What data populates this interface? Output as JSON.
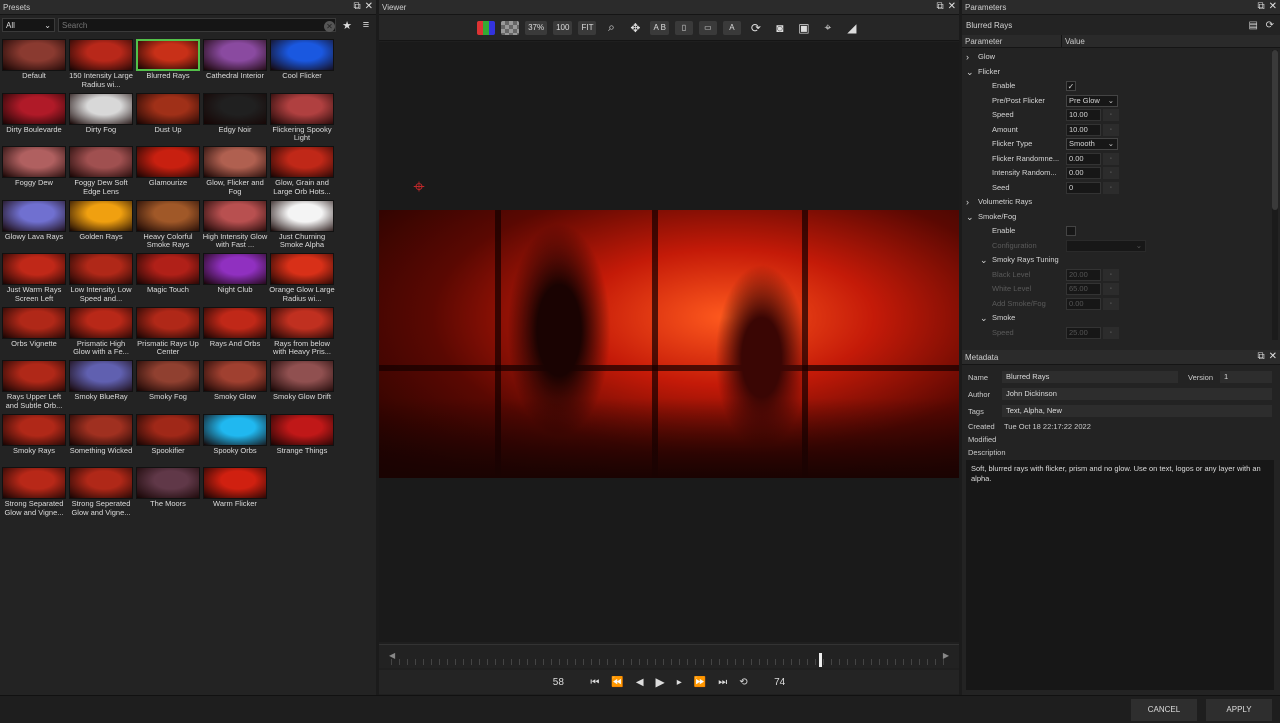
{
  "presets": {
    "title": "Presets",
    "filter": "All",
    "search_placeholder": "Search",
    "items": [
      {
        "label": "Default",
        "color": "#8a3a30"
      },
      {
        "label": "150 Intensity Large Radius wi...",
        "color": "#b8281a"
      },
      {
        "label": "Blurred Rays",
        "color": "#c83018"
      },
      {
        "label": "Cathedral Interior",
        "color": "#8a4aa0"
      },
      {
        "label": "Cool Flicker",
        "color": "#1a58e0"
      },
      {
        "label": "Dirty Boulevarde",
        "color": "#b01a28"
      },
      {
        "label": "Dirty Fog",
        "color": "#d8d8d8"
      },
      {
        "label": "Dust Up",
        "color": "#a03018"
      },
      {
        "label": "Edgy Noir",
        "color": "#202020"
      },
      {
        "label": "Flickering Spooky Light",
        "color": "#b04040"
      },
      {
        "label": "Foggy Dew",
        "color": "#b06060"
      },
      {
        "label": "Foggy Dew Soft Edge Lens",
        "color": "#a05050"
      },
      {
        "label": "Glamourize",
        "color": "#c82010"
      },
      {
        "label": "Glow, Flicker and Fog",
        "color": "#b06050"
      },
      {
        "label": "Glow, Grain and Large Orb Hots...",
        "color": "#c02818"
      },
      {
        "label": "Glowy Lava Rays",
        "color": "#7070d0"
      },
      {
        "label": "Golden Rays",
        "color": "#f0a010"
      },
      {
        "label": "Heavy Colorful Smoke Rays",
        "color": "#a05828"
      },
      {
        "label": "High Intensity Glow with Fast ...",
        "color": "#b85050"
      },
      {
        "label": "Just Churning Smoke Alpha",
        "color": "#f4f4f4"
      },
      {
        "label": "Just Warm Rays Screen Left",
        "color": "#c02818"
      },
      {
        "label": "Low Intensity, Low Speed and...",
        "color": "#b02818"
      },
      {
        "label": "Magic Touch",
        "color": "#b02018"
      },
      {
        "label": "Night Club",
        "color": "#9030c0"
      },
      {
        "label": "Orange Glow Large Radius wi...",
        "color": "#d83018"
      },
      {
        "label": "Orbs Vignette",
        "color": "#b02818"
      },
      {
        "label": "Prismatic High Glow with a Fe...",
        "color": "#b82818"
      },
      {
        "label": "Prismatic Rays Up Center",
        "color": "#b02818"
      },
      {
        "label": "Rays And Orbs",
        "color": "#c02818"
      },
      {
        "label": "Rays from below with Heavy Pris...",
        "color": "#c03020"
      },
      {
        "label": "Rays Upper Left and Subtle Orb...",
        "color": "#b02818"
      },
      {
        "label": "Smoky BlueRay",
        "color": "#6060b0"
      },
      {
        "label": "Smoky Fog",
        "color": "#904030"
      },
      {
        "label": "Smoky Glow",
        "color": "#a04030"
      },
      {
        "label": "Smoky Glow Drift",
        "color": "#905050"
      },
      {
        "label": "Smoky Rays",
        "color": "#b02818"
      },
      {
        "label": "Something Wicked",
        "color": "#a03020"
      },
      {
        "label": "Spookifier",
        "color": "#a02818"
      },
      {
        "label": "Spooky Orbs",
        "color": "#20b8f0"
      },
      {
        "label": "Strange Things",
        "color": "#c01818"
      },
      {
        "label": "Strong Separated Glow and Vigne...",
        "color": "#b82818"
      },
      {
        "label": "Strong Seperated Glow and Vigne...",
        "color": "#b02818"
      },
      {
        "label": "The Moors",
        "color": "#603848"
      },
      {
        "label": "Warm Flicker",
        "color": "#d02010"
      }
    ]
  },
  "viewer": {
    "title": "Viewer",
    "zoom": "37%",
    "btn_100": "100",
    "btn_fit": "FIT",
    "btn_ab": "A B",
    "frame_start": "58",
    "frame_end": "74",
    "playhead_fraction": 0.77
  },
  "parameters": {
    "title": "Parameters",
    "preset_name": "Blurred Rays",
    "col_param": "Parameter",
    "col_value": "Value",
    "rows": [
      {
        "label": "Glow",
        "indent": 0,
        "type": "group",
        "open": false
      },
      {
        "label": "Flicker",
        "indent": 0,
        "type": "group",
        "open": true
      },
      {
        "label": "Enable",
        "indent": 2,
        "type": "check",
        "value": "✓"
      },
      {
        "label": "Pre/Post Flicker",
        "indent": 2,
        "type": "drop",
        "value": "Pre Glow"
      },
      {
        "label": "Speed",
        "indent": 2,
        "type": "num",
        "value": "10.00"
      },
      {
        "label": "Amount",
        "indent": 2,
        "type": "num",
        "value": "10.00"
      },
      {
        "label": "Flicker Type",
        "indent": 2,
        "type": "drop",
        "value": "Smooth"
      },
      {
        "label": "Flicker Randomne...",
        "indent": 2,
        "type": "num",
        "value": "0.00"
      },
      {
        "label": "Intensity Random...",
        "indent": 2,
        "type": "num",
        "value": "0.00"
      },
      {
        "label": "Seed",
        "indent": 2,
        "type": "num",
        "value": "0"
      },
      {
        "label": "Volumetric Rays",
        "indent": 0,
        "type": "group",
        "open": false
      },
      {
        "label": "Smoke/Fog",
        "indent": 0,
        "type": "group",
        "open": true
      },
      {
        "label": "Enable",
        "indent": 2,
        "type": "check",
        "value": ""
      },
      {
        "label": "Configuration",
        "indent": 2,
        "type": "dimdrop",
        "value": ""
      },
      {
        "label": "Smoky Rays Tuning",
        "indent": 1,
        "type": "group",
        "open": true
      },
      {
        "label": "Black Level",
        "indent": 2,
        "type": "dimnum",
        "value": "20.00"
      },
      {
        "label": "White Level",
        "indent": 2,
        "type": "dimnum",
        "value": "65.00"
      },
      {
        "label": "Add Smoke/Fog",
        "indent": 2,
        "type": "dimnum",
        "value": "0.00"
      },
      {
        "label": "Smoke",
        "indent": 1,
        "type": "group",
        "open": true
      },
      {
        "label": "Speed",
        "indent": 2,
        "type": "dimnum",
        "value": "25.00"
      }
    ]
  },
  "metadata": {
    "title": "Metadata",
    "name_label": "Name",
    "name": "Blurred Rays",
    "version_label": "Version",
    "version": "1",
    "author_label": "Author",
    "author": "John Dickinson",
    "tags_label": "Tags",
    "tags": "Text, Alpha, New",
    "created_label": "Created",
    "created": "Tue Oct 18 22:17:22 2022",
    "modified_label": "Modified",
    "description_label": "Description",
    "description": "Soft, blurred rays with flicker, prism and no glow. Use on text, logos or any layer with an alpha."
  },
  "footer": {
    "cancel": "CANCEL",
    "apply": "APPLY"
  }
}
